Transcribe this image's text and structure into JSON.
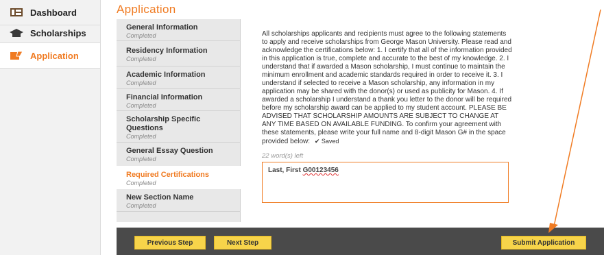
{
  "nav": {
    "items": [
      {
        "label": "Dashboard",
        "icon": "dashboard-icon"
      },
      {
        "label": "Scholarships",
        "icon": "graduation-cap-icon"
      },
      {
        "label": "Application",
        "icon": "application-icon",
        "active": true
      }
    ]
  },
  "header": {
    "title": "Application"
  },
  "steps": [
    {
      "title": "General Information",
      "status": "Completed"
    },
    {
      "title": "Residency Information",
      "status": "Completed"
    },
    {
      "title": "Academic Information",
      "status": "Completed"
    },
    {
      "title": "Financial Information",
      "status": "Completed"
    },
    {
      "title": "Scholarship Specific Questions",
      "status": "Completed"
    },
    {
      "title": "General Essay Question",
      "status": "Completed"
    },
    {
      "title": "Required Certifications",
      "status": "Completed",
      "current": true
    },
    {
      "title": "New Section Name",
      "status": "Completed"
    }
  ],
  "content": {
    "certification_text": "All scholarships applicants and recipients must agree to the following statements to apply and receive scholarships from George Mason University. Please read and acknowledge the certifications below: 1. I certify that all of the information provided in this application is true, complete and accurate to the best of my knowledge. 2. I understand that if awarded a Mason scholarship, I must continue to maintain the minimum enrollment and academic standards required in order to receive it. 3. I understand if selected to receive a Mason scholarship, any information in my application may be shared with the donor(s) or used as publicity for Mason. 4. If awarded a scholarship I understand a thank you letter to the donor will be required before my scholarship award can be applied to my student account. PLEASE BE ADVISED THAT SCHOLARSHIP AMOUNTS ARE SUBJECT TO CHANGE AT ANY TIME BASED ON AVAILABLE FUNDING. To confirm your agreement with these statements, please write your full name and 8-digit Mason G# in the space provided below:",
    "saved_label": "Saved",
    "words_left": "22 word(s) left",
    "answer_name": "Last, First ",
    "answer_gnumber": "G00123456"
  },
  "footer": {
    "previous_label": "Previous Step",
    "next_label": "Next Step",
    "submit_label": "Submit Application"
  },
  "colors": {
    "accent": "#f07b22",
    "button": "#f7d44a",
    "footer_bg": "#4a4a4a"
  }
}
